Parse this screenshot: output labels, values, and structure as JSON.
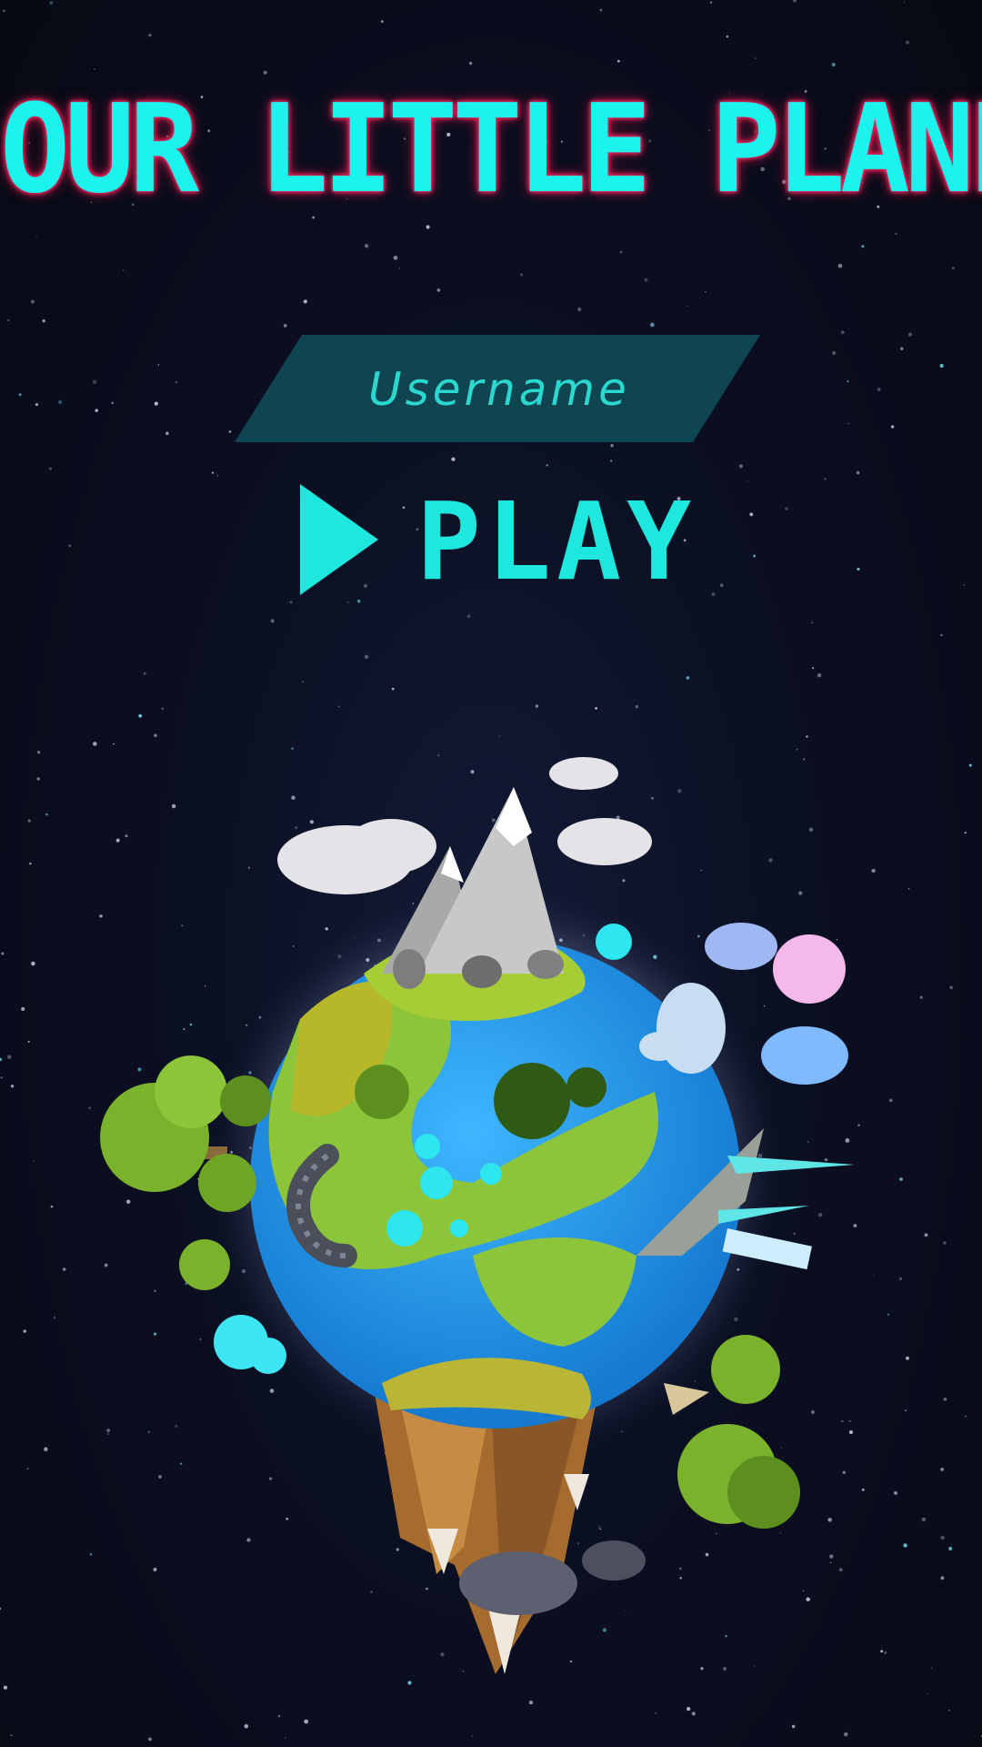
{
  "title": "OUR LITTLE PLANET",
  "username": {
    "placeholder": "Username",
    "value": ""
  },
  "play_button": {
    "label": "PLAY",
    "icon": "play-triangle-icon"
  },
  "planet": {
    "icon": "low-poly-planet-illustration"
  },
  "colors": {
    "accent": "#1ee7de",
    "title_glow": "#e0184a",
    "input_background": "#0f4550",
    "background": "#090c1b"
  }
}
